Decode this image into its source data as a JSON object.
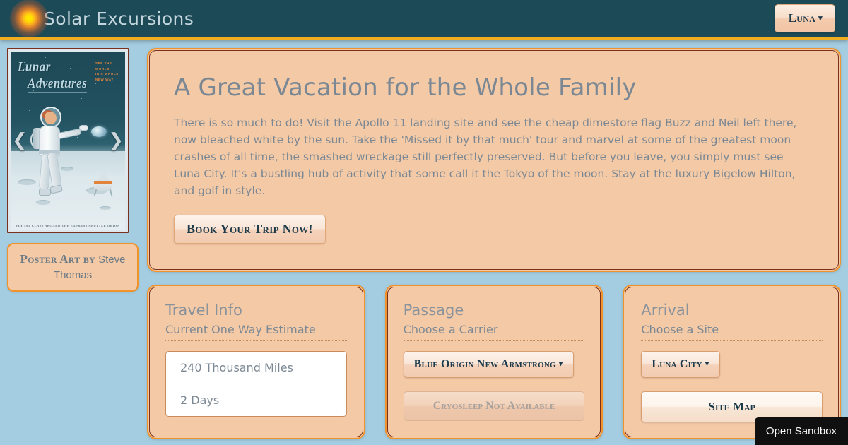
{
  "header": {
    "brand": "Solar Excursions",
    "sun_icon": "sun-icon",
    "user_button": "Luna",
    "caret": "▾",
    "accent_gold": "#f0ad20",
    "header_bg": "#1d4a57"
  },
  "carousel": {
    "prev_icon": "❮",
    "next_icon": "❯",
    "poster": {
      "title_line1": "Lunar",
      "title_line2": "Adventures",
      "tagline": "SEE THE\nWORLD\nIN A WHOLE\nNEW WAY",
      "footer": "FLY 1ST CLASS ABOARD THE EXPRESS SHUTTLE ORION"
    },
    "credit_prefix": "Poster Art by",
    "credit_artist": "Steve Thomas"
  },
  "hero": {
    "heading": "A Great Vacation for the Whole Family",
    "body": "There is so much to do! Visit the Apollo 11 landing site and see the cheap dimestore flag Buzz and Neil left there, now bleached white by the sun. Take the 'Missed it by that much' tour and marvel at some of the greatest moon crashes of all time, the smashed wreckage still perfectly preserved. But before you leave, you simply must see Luna City. It's a bustling hub of activity that some call it the Tokyo of the moon. Stay at the luxury Bigelow Hilton, and golf in style.",
    "cta": "Book Your Trip Now!"
  },
  "cards": [
    {
      "title": "Travel Info",
      "subtitle": "Current One Way Estimate",
      "items": [
        "240 Thousand Miles",
        "2 Days"
      ]
    },
    {
      "title": "Passage",
      "subtitle": "Choose a Carrier",
      "carrier_selected": "Blue Origin New Armstrong",
      "caret": "▾",
      "cryosleep_label": "Cryosleep Not Available"
    },
    {
      "title": "Arrival",
      "subtitle": "Choose a Site",
      "site_selected": "Luna City",
      "caret": "▾",
      "site_map_label": "Site Map"
    }
  ],
  "tooltip": {
    "label": "Open Sandbox"
  },
  "colors": {
    "page_bg": "#a5cde1",
    "panel_bg": "#f3c9a6",
    "panel_border_outer": "#f0932a",
    "panel_border_inner": "#7b2f1d",
    "muted_text": "#7b8894",
    "dark_text": "#1d3a4a"
  }
}
